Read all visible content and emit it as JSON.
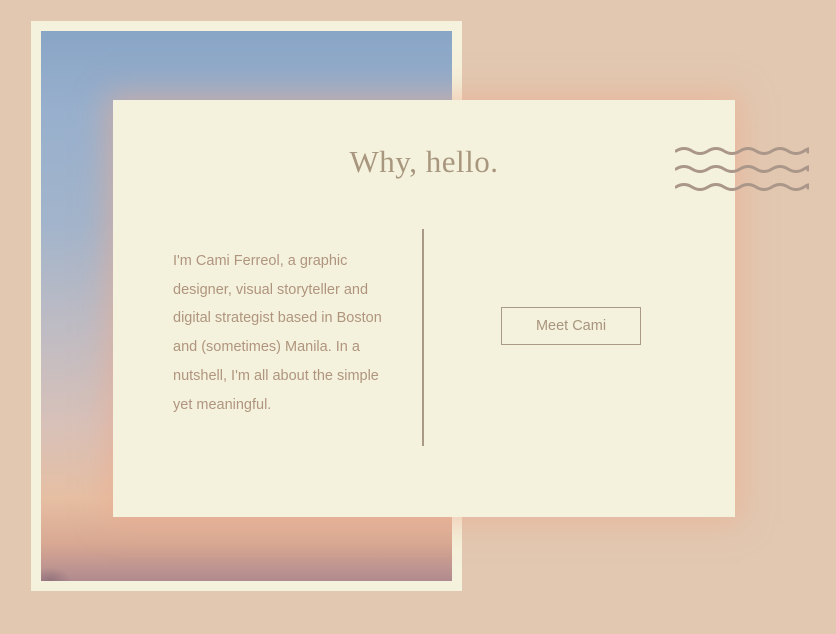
{
  "card": {
    "title": "Why, hello.",
    "bio": "I'm Cami Ferreol, a graphic designer, visual storyteller and digital strategist based in Boston and (sometimes) Manila. In a nutshell, I'm all about the simple yet meaningful.",
    "button_label": "Meet Cami"
  },
  "decor": {
    "photo": "sunset-sky-photo",
    "stamp": "postmark-waves-icon"
  },
  "colors": {
    "background": "#e2c8b1",
    "card": "#f4f2dd",
    "text": "#b0957e",
    "accent": "#a99a86"
  }
}
